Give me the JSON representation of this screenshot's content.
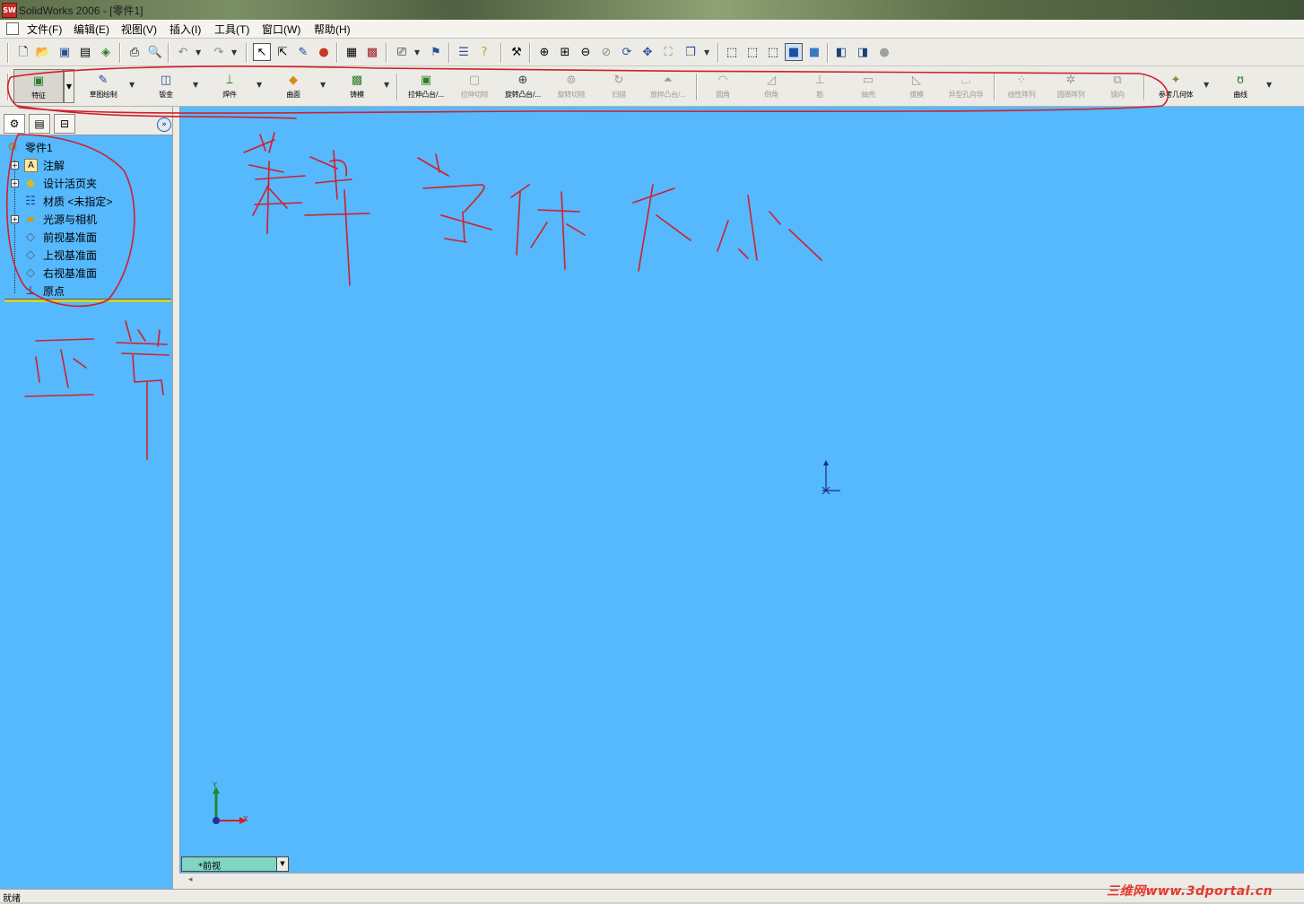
{
  "window": {
    "title": "SolidWorks 2006 - [零件1]",
    "app_icon": "SW"
  },
  "menu": [
    "文件(F)",
    "编辑(E)",
    "视图(V)",
    "插入(I)",
    "工具(T)",
    "窗口(W)",
    "帮助(H)"
  ],
  "standard_toolbar": {
    "icons": [
      "new-icon",
      "open-icon",
      "save-icon",
      "print-icon",
      "print-preview-icon",
      "undo-icon",
      "redo-icon",
      "select-icon",
      "smart-dimension-icon",
      "sketch-icon",
      "rebuild-icon",
      "grid-icon",
      "options-icon",
      "zoom-to-fit-icon",
      "zoom-area-icon",
      "zoom-in-out-icon",
      "zoom-selection-icon",
      "rotate-icon",
      "pan-icon",
      "view-orientation-icon"
    ]
  },
  "feature_toolbar": {
    "groups": [
      {
        "label": "特征",
        "icon": "features-icon",
        "enabled": true,
        "selected": true
      },
      {
        "label": "草图绘制",
        "icon": "sketch-icon",
        "enabled": true
      },
      {
        "label": "钣金",
        "icon": "sheet-metal-icon",
        "enabled": true
      },
      {
        "label": "焊件",
        "icon": "weldments-icon",
        "enabled": true
      },
      {
        "label": "曲面",
        "icon": "surfaces-icon",
        "enabled": true
      },
      {
        "label": "铸模",
        "icon": "mold-tools-icon",
        "enabled": true
      }
    ],
    "tools": [
      {
        "label": "拉伸凸台/...",
        "icon": "extruded-boss-icon",
        "enabled": true
      },
      {
        "label": "拉伸切除",
        "icon": "extruded-cut-icon",
        "enabled": false
      },
      {
        "label": "旋转凸台/...",
        "icon": "revolved-boss-icon",
        "enabled": true
      },
      {
        "label": "旋转切除",
        "icon": "revolved-cut-icon",
        "enabled": false
      },
      {
        "label": "扫描",
        "icon": "sweep-icon",
        "enabled": false
      },
      {
        "label": "放样凸台/...",
        "icon": "loft-icon",
        "enabled": false
      },
      {
        "label": "圆角",
        "icon": "fillet-icon",
        "enabled": false
      },
      {
        "label": "倒角",
        "icon": "chamfer-icon",
        "enabled": false
      },
      {
        "label": "筋",
        "icon": "rib-icon",
        "enabled": false
      },
      {
        "label": "抽壳",
        "icon": "shell-icon",
        "enabled": false
      },
      {
        "label": "拔模",
        "icon": "draft-icon",
        "enabled": false
      },
      {
        "label": "异型孔向导",
        "icon": "hole-wizard-icon",
        "enabled": false
      },
      {
        "label": "线性阵列",
        "icon": "linear-pattern-icon",
        "enabled": false
      },
      {
        "label": "圆周阵列",
        "icon": "circular-pattern-icon",
        "enabled": false
      },
      {
        "label": "镜向",
        "icon": "mirror-icon",
        "enabled": false
      },
      {
        "label": "参考几何体",
        "icon": "reference-geometry-icon",
        "enabled": true
      },
      {
        "label": "曲线",
        "icon": "curves-icon",
        "enabled": true
      }
    ]
  },
  "feature_tree": {
    "root": "零件1",
    "items": [
      {
        "label": "注解",
        "expandable": true,
        "icon": "annotations-icon"
      },
      {
        "label": "设计活页夹",
        "expandable": true,
        "icon": "design-binder-icon"
      },
      {
        "label": "材质 <未指定>",
        "expandable": false,
        "icon": "material-icon"
      },
      {
        "label": "光源与相机",
        "expandable": true,
        "icon": "lights-cameras-icon"
      },
      {
        "label": "前视基准面",
        "expandable": false,
        "icon": "plane-icon"
      },
      {
        "label": "上视基准面",
        "expandable": false,
        "icon": "plane-icon"
      },
      {
        "label": "右视基准面",
        "expandable": false,
        "icon": "plane-icon"
      },
      {
        "label": "原点",
        "expandable": false,
        "icon": "origin-icon"
      }
    ]
  },
  "viewport": {
    "background": "#56b8fd",
    "view_name": "*前视",
    "triad_y": "Y",
    "triad_x": "X"
  },
  "status": {
    "text": "就绪"
  },
  "watermark": "三维网www.3dportal.cn",
  "colors": {
    "viewport": "#56b8fd",
    "annotation": "#d0202a"
  }
}
